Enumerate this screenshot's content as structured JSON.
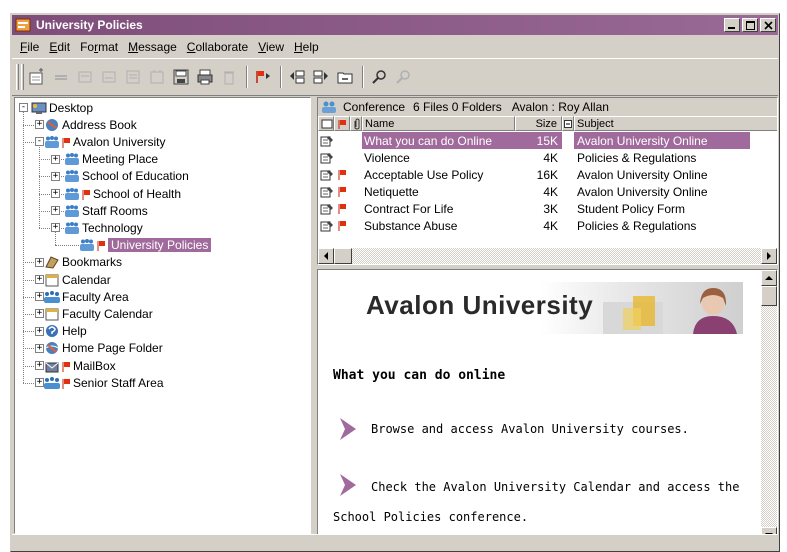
{
  "window": {
    "title": "University Policies"
  },
  "menu": [
    "File",
    "Edit",
    "Format",
    "Message",
    "Collaborate",
    "View",
    "Help"
  ],
  "menu_mnemonics": [
    "F",
    "E",
    "r",
    "M",
    "C",
    "V",
    "H"
  ],
  "tree": {
    "items": [
      {
        "label": "Desktop",
        "icon": "desktop-icon"
      },
      {
        "label": "Address Book",
        "icon": "address-book-icon"
      },
      {
        "label": "Avalon University",
        "icon": "conference-icon"
      },
      {
        "label": "Meeting Place",
        "icon": "conference-icon"
      },
      {
        "label": "School of Education",
        "icon": "conference-icon"
      },
      {
        "label": "School of Health",
        "icon": "conference-icon"
      },
      {
        "label": "Staff Rooms",
        "icon": "conference-icon"
      },
      {
        "label": "Technology",
        "icon": "conference-icon"
      },
      {
        "label": "University Policies",
        "icon": "conference-icon"
      },
      {
        "label": "Bookmarks",
        "icon": "bookmarks-icon"
      },
      {
        "label": "Calendar",
        "icon": "calendar-icon"
      },
      {
        "label": "Faculty Area",
        "icon": "group-icon"
      },
      {
        "label": "Faculty Calendar",
        "icon": "calendar-icon"
      },
      {
        "label": "Help",
        "icon": "help-icon"
      },
      {
        "label": "Home Page Folder",
        "icon": "home-page-icon"
      },
      {
        "label": "MailBox",
        "icon": "mailbox-icon"
      },
      {
        "label": "Senior Staff Area",
        "icon": "group-icon"
      }
    ]
  },
  "list": {
    "header": {
      "folder": "Conference",
      "counts": "6 Files 0 Folders",
      "owner": "Avalon : Roy Allan"
    },
    "columns": {
      "name": "Name",
      "size": "Size",
      "subject": "Subject"
    },
    "rows": [
      {
        "name": "What you can do Online",
        "size": "15K",
        "subject": "Avalon University Online",
        "flagged": false
      },
      {
        "name": "Violence",
        "size": "4K",
        "subject": "Policies & Regulations",
        "flagged": false
      },
      {
        "name": "Acceptable Use Policy",
        "size": "16K",
        "subject": "Avalon University Online",
        "flagged": true
      },
      {
        "name": "Netiquette",
        "size": "4K",
        "subject": "Avalon University Online",
        "flagged": true
      },
      {
        "name": "Contract For Life",
        "size": "3K",
        "subject": "Student Policy Form",
        "flagged": true
      },
      {
        "name": "Substance Abuse",
        "size": "4K",
        "subject": "Policies & Regulations",
        "flagged": true
      }
    ]
  },
  "preview": {
    "banner": "Avalon University",
    "heading": "What you can do online",
    "bullets": [
      "Browse and access Avalon University courses.",
      "Check the Avalon University Calendar and access the"
    ],
    "continuation": "School Policies conference."
  },
  "colors": {
    "titlebar": "#7e4d7a",
    "selection": "#a06a9c",
    "flag": "#e03010",
    "chrome": "#d4d0c8"
  }
}
